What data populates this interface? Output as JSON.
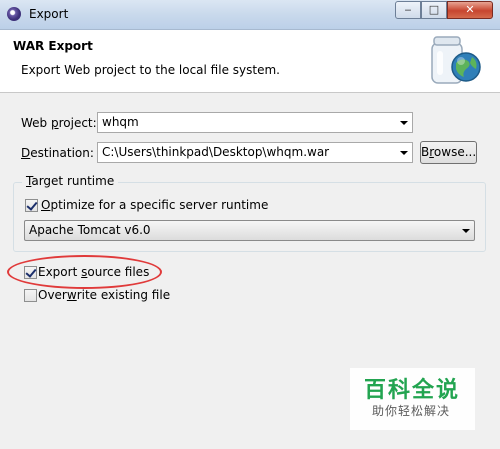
{
  "window": {
    "title": "Export",
    "minimize": "‒",
    "maximize": "□",
    "close": "✕"
  },
  "header": {
    "title": "WAR Export",
    "description": "Export Web project to the local file system.",
    "icon": "jar-globe-icon"
  },
  "form": {
    "web_project_label_pre": "Web ",
    "web_project_label_key": "p",
    "web_project_label_post": "roject:",
    "web_project_value": "whqm",
    "destination_label_key": "D",
    "destination_label_post": "estination:",
    "destination_value": "C:\\Users\\thinkpad\\Desktop\\whqm.war",
    "browse_label_pre": "B",
    "browse_label_key": "r",
    "browse_label_post": "owse..."
  },
  "target_runtime": {
    "title_key": "T",
    "title_post": "arget runtime",
    "optimize_label_key": "O",
    "optimize_label_post": "ptimize for a specific server runtime",
    "optimize_checked": true,
    "runtime_value": "Apache Tomcat v6.0"
  },
  "options": {
    "export_source_pre": "Export ",
    "export_source_key": "s",
    "export_source_post": "ource files",
    "export_source_checked": true,
    "overwrite_pre": "Over",
    "overwrite_key": "w",
    "overwrite_post": "rite existing file",
    "overwrite_checked": false
  },
  "watermark": {
    "title": "百科全说",
    "subtitle": "助你轻松解决"
  },
  "colors": {
    "highlight": "#e03a3a",
    "watermark_green": "#1aa14a"
  }
}
